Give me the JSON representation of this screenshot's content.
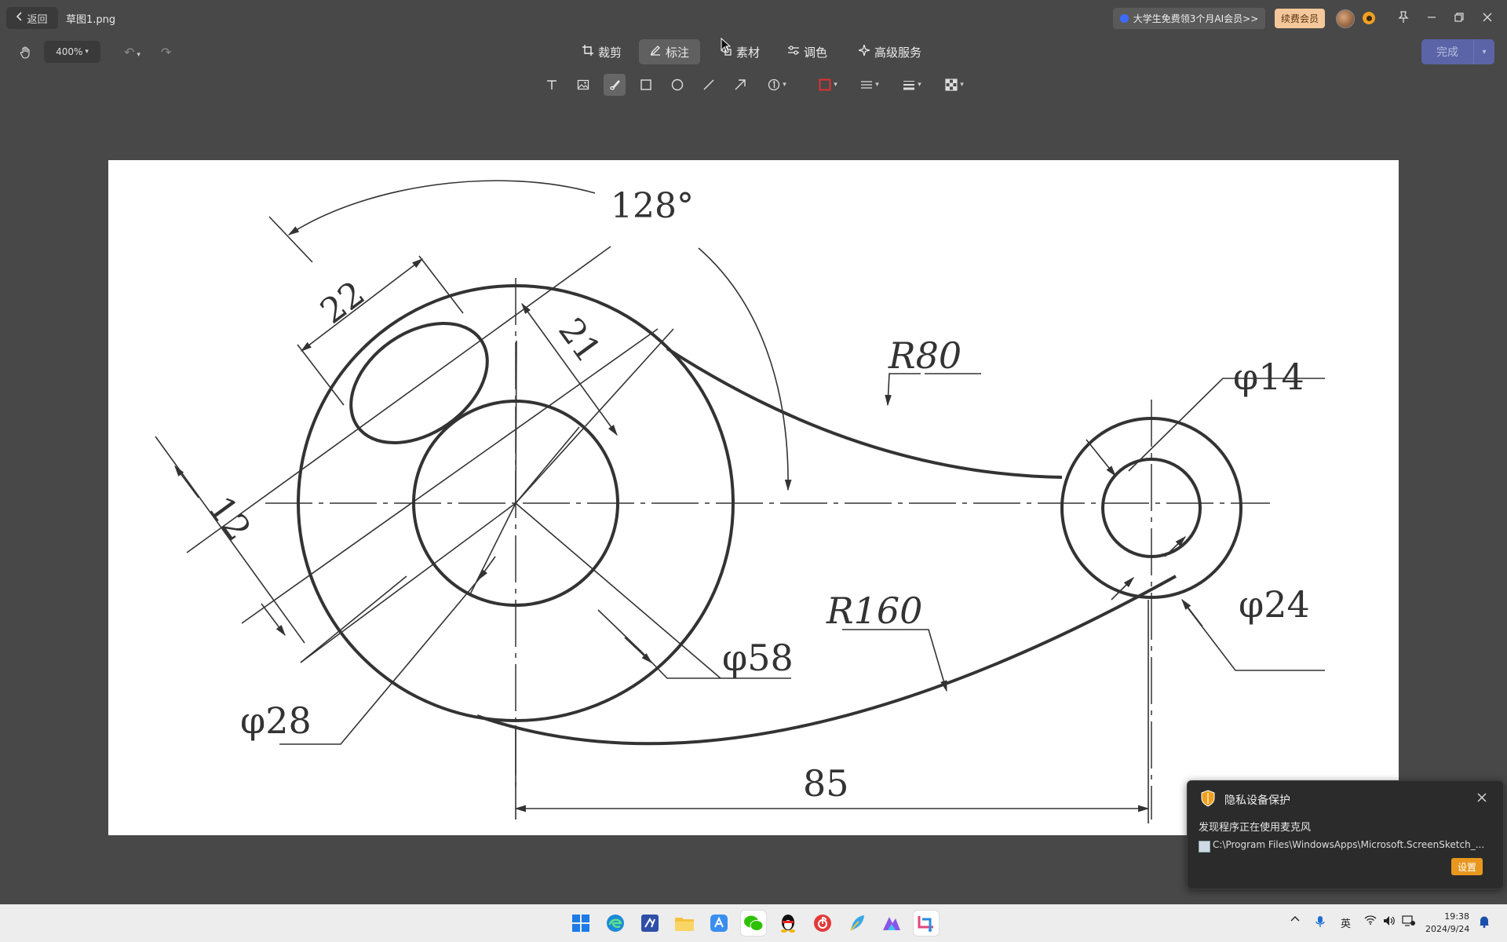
{
  "titlebar": {
    "back_label": "返回",
    "filename": "草图1.png",
    "promo_text": "大学生免费领3个月AI会员>>",
    "renew_label": "续费会员"
  },
  "toolbar": {
    "zoom_value": "400%",
    "tabs": [
      {
        "label": "裁剪",
        "icon": "crop-icon"
      },
      {
        "label": "标注",
        "icon": "annotate-pen-icon"
      },
      {
        "label": "素材",
        "icon": "material-icon"
      },
      {
        "label": "调色",
        "icon": "adjust-color-icon"
      },
      {
        "label": "高级服务",
        "icon": "sparkle-icon"
      }
    ],
    "done_label": "完成",
    "tools": [
      "text-tool-icon",
      "image-tool-icon",
      "brush-tool-icon",
      "rectangle-tool-icon",
      "ellipse-tool-icon",
      "line-tool-icon",
      "arrow-tool-icon",
      "number-marker-tool-icon",
      "color-swatch-icon",
      "line-style-icon",
      "line-weight-icon",
      "mosaic-tool-icon"
    ],
    "color_swatch": "#e03030"
  },
  "drawing": {
    "dims": {
      "angle": "128°",
      "d22": "22",
      "d21": "21",
      "d12": "12",
      "r80": "R80",
      "r160": "R160",
      "phi14": "φ14",
      "phi24": "φ24",
      "phi58": "φ58",
      "phi28": "φ28",
      "d85": "85"
    }
  },
  "notification": {
    "title": "隐私设备保护",
    "message": "发现程序正在使用麦克风",
    "path": "C:\\Program Files\\WindowsApps\\Microsoft.ScreenSketch_...",
    "settings_label": "设置"
  },
  "taskbar": {
    "apps": [
      "windows-start-icon",
      "edge-browser-icon",
      "editor-app-icon",
      "file-explorer-icon",
      "app-store-icon",
      "wechat-icon",
      "qq-penguin-icon",
      "netease-music-icon",
      "feather-app-icon",
      "ai-app-icon",
      "snipping-tool-icon"
    ],
    "ime_label": "英",
    "time": "19:38",
    "date": "2024/9/24"
  }
}
